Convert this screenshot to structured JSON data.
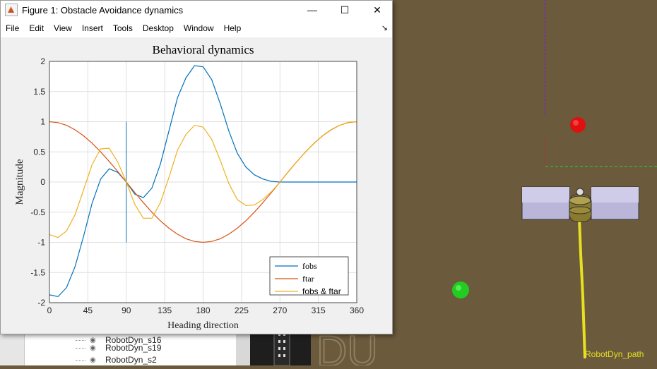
{
  "window": {
    "title": "Figure 1: Obstacle Avoidance dynamics",
    "controls": {
      "minimize": "—",
      "maximize": "☐",
      "close": "✕"
    },
    "menu": [
      "File",
      "Edit",
      "View",
      "Insert",
      "Tools",
      "Desktop",
      "Window",
      "Help"
    ],
    "dock_glyph": "↘"
  },
  "scene": {
    "path_label": "RobotDyn_path",
    "tree_items": [
      "RobotDyn_s16",
      "RobotDyn_s19",
      "RobotDyn_s2"
    ],
    "obstacle_color": "#e01010",
    "target_color": "#22cc22",
    "path_color": "#e6e020",
    "ground_color": "#6b5a3c"
  },
  "chart_data": {
    "type": "line",
    "title": "Behavioral dynamics",
    "xlabel": "Heading direction",
    "ylabel": "Magnitude",
    "xlim": [
      0,
      360
    ],
    "ylim": [
      -2,
      2
    ],
    "xticks": [
      0,
      45,
      90,
      135,
      180,
      225,
      270,
      315,
      360
    ],
    "yticks": [
      2,
      1.5,
      1,
      0.5,
      0,
      -0.5,
      -1,
      -1.5,
      -2
    ],
    "grid": true,
    "legend_position": "bottom-right",
    "vertical_marker": {
      "x": 90,
      "y_range": [
        -1,
        1
      ],
      "color": "#4a90c8"
    },
    "series": [
      {
        "name": "fobs",
        "color": "#0072bd",
        "x": [
          0,
          10,
          20,
          30,
          40,
          50,
          60,
          70,
          80,
          90,
          100,
          110,
          120,
          130,
          140,
          150,
          160,
          170,
          180,
          190,
          200,
          210,
          220,
          230,
          240,
          250,
          260,
          270,
          280,
          290,
          300,
          310,
          320,
          330,
          340,
          350,
          360
        ],
        "y": [
          -1.87,
          -1.9,
          -1.75,
          -1.4,
          -0.9,
          -0.35,
          0.05,
          0.22,
          0.16,
          0,
          -0.2,
          -0.26,
          -0.1,
          0.3,
          0.85,
          1.4,
          1.73,
          1.93,
          1.91,
          1.7,
          1.3,
          0.85,
          0.48,
          0.25,
          0.12,
          0.05,
          0.01,
          0,
          0,
          0,
          0,
          0,
          0,
          0,
          0,
          0,
          0
        ]
      },
      {
        "name": "ftar",
        "color": "#d95319",
        "x": [
          0,
          10,
          20,
          30,
          40,
          50,
          60,
          70,
          80,
          90,
          100,
          110,
          120,
          130,
          140,
          150,
          160,
          170,
          180,
          190,
          200,
          210,
          220,
          230,
          240,
          250,
          260,
          270,
          280,
          290,
          300,
          310,
          320,
          330,
          340,
          350,
          360
        ],
        "y": [
          1,
          0.985,
          0.94,
          0.866,
          0.766,
          0.643,
          0.5,
          0.342,
          0.174,
          0,
          -0.174,
          -0.342,
          -0.5,
          -0.643,
          -0.766,
          -0.866,
          -0.94,
          -0.985,
          -1,
          -0.985,
          -0.94,
          -0.866,
          -0.766,
          -0.643,
          -0.5,
          -0.342,
          -0.174,
          0,
          0.174,
          0.342,
          0.5,
          0.643,
          0.766,
          0.866,
          0.94,
          0.985,
          1
        ]
      },
      {
        "name": "fobs & ftar",
        "color": "#edb120",
        "x": [
          0,
          10,
          20,
          30,
          40,
          50,
          60,
          70,
          80,
          90,
          100,
          110,
          120,
          130,
          140,
          150,
          160,
          170,
          180,
          190,
          200,
          210,
          220,
          230,
          240,
          250,
          260,
          270,
          280,
          290,
          300,
          310,
          320,
          330,
          340,
          350,
          360
        ],
        "y": [
          -0.87,
          -0.92,
          -0.81,
          -0.54,
          -0.13,
          0.29,
          0.55,
          0.56,
          0.33,
          0,
          -0.37,
          -0.6,
          -0.6,
          -0.34,
          0.08,
          0.53,
          0.79,
          0.94,
          0.91,
          0.71,
          0.36,
          -0.02,
          -0.29,
          -0.39,
          -0.38,
          -0.29,
          -0.16,
          0,
          0.17,
          0.34,
          0.5,
          0.64,
          0.77,
          0.87,
          0.94,
          0.99,
          1
        ]
      }
    ]
  }
}
